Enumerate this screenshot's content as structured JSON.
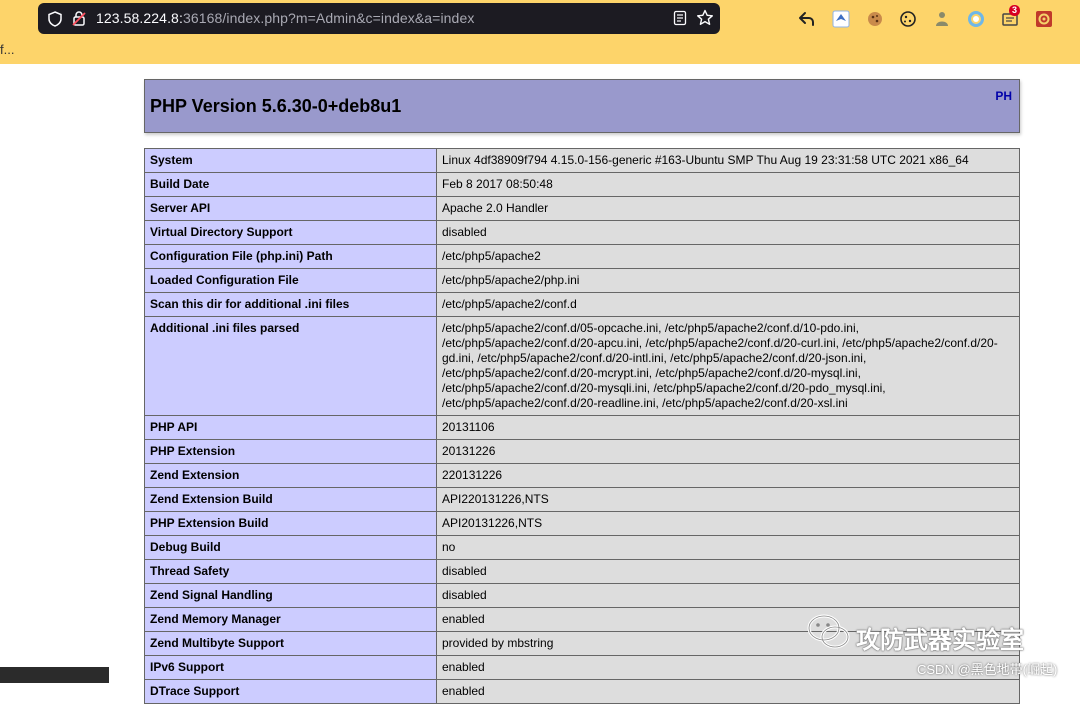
{
  "browser": {
    "url_main": "123.58.224.8:",
    "url_port_path": "36168/index.php?m=Admin&c=index&a=index",
    "notification_count": "3",
    "elided_text": "f..."
  },
  "header": {
    "title": "PHP Version 5.6.30-0+deb8u1",
    "logo": "PH"
  },
  "rows": [
    {
      "key": "System",
      "value": "Linux 4df38909f794 4.15.0-156-generic #163-Ubuntu SMP Thu Aug 19 23:31:58 UTC 2021 x86_64"
    },
    {
      "key": "Build Date",
      "value": "Feb 8 2017 08:50:48"
    },
    {
      "key": "Server API",
      "value": "Apache 2.0 Handler"
    },
    {
      "key": "Virtual Directory Support",
      "value": "disabled"
    },
    {
      "key": "Configuration File (php.ini) Path",
      "value": "/etc/php5/apache2"
    },
    {
      "key": "Loaded Configuration File",
      "value": "/etc/php5/apache2/php.ini"
    },
    {
      "key": "Scan this dir for additional .ini files",
      "value": "/etc/php5/apache2/conf.d"
    },
    {
      "key": "Additional .ini files parsed",
      "value": "/etc/php5/apache2/conf.d/05-opcache.ini, /etc/php5/apache2/conf.d/10-pdo.ini, /etc/php5/apache2/conf.d/20-apcu.ini, /etc/php5/apache2/conf.d/20-curl.ini, /etc/php5/apache2/conf.d/20-gd.ini, /etc/php5/apache2/conf.d/20-intl.ini, /etc/php5/apache2/conf.d/20-json.ini, /etc/php5/apache2/conf.d/20-mcrypt.ini, /etc/php5/apache2/conf.d/20-mysql.ini, /etc/php5/apache2/conf.d/20-mysqli.ini, /etc/php5/apache2/conf.d/20-pdo_mysql.ini, /etc/php5/apache2/conf.d/20-readline.ini, /etc/php5/apache2/conf.d/20-xsl.ini"
    },
    {
      "key": "PHP API",
      "value": "20131106"
    },
    {
      "key": "PHP Extension",
      "value": "20131226"
    },
    {
      "key": "Zend Extension",
      "value": "220131226"
    },
    {
      "key": "Zend Extension Build",
      "value": "API220131226,NTS"
    },
    {
      "key": "PHP Extension Build",
      "value": "API20131226,NTS"
    },
    {
      "key": "Debug Build",
      "value": "no"
    },
    {
      "key": "Thread Safety",
      "value": "disabled"
    },
    {
      "key": "Zend Signal Handling",
      "value": "disabled"
    },
    {
      "key": "Zend Memory Manager",
      "value": "enabled"
    },
    {
      "key": "Zend Multibyte Support",
      "value": "provided by mbstring"
    },
    {
      "key": "IPv6 Support",
      "value": "enabled"
    },
    {
      "key": "DTrace Support",
      "value": "enabled"
    }
  ],
  "watermark": {
    "title": "攻防武器实验室",
    "sub": "CSDN @黑色地带(崛起)"
  }
}
